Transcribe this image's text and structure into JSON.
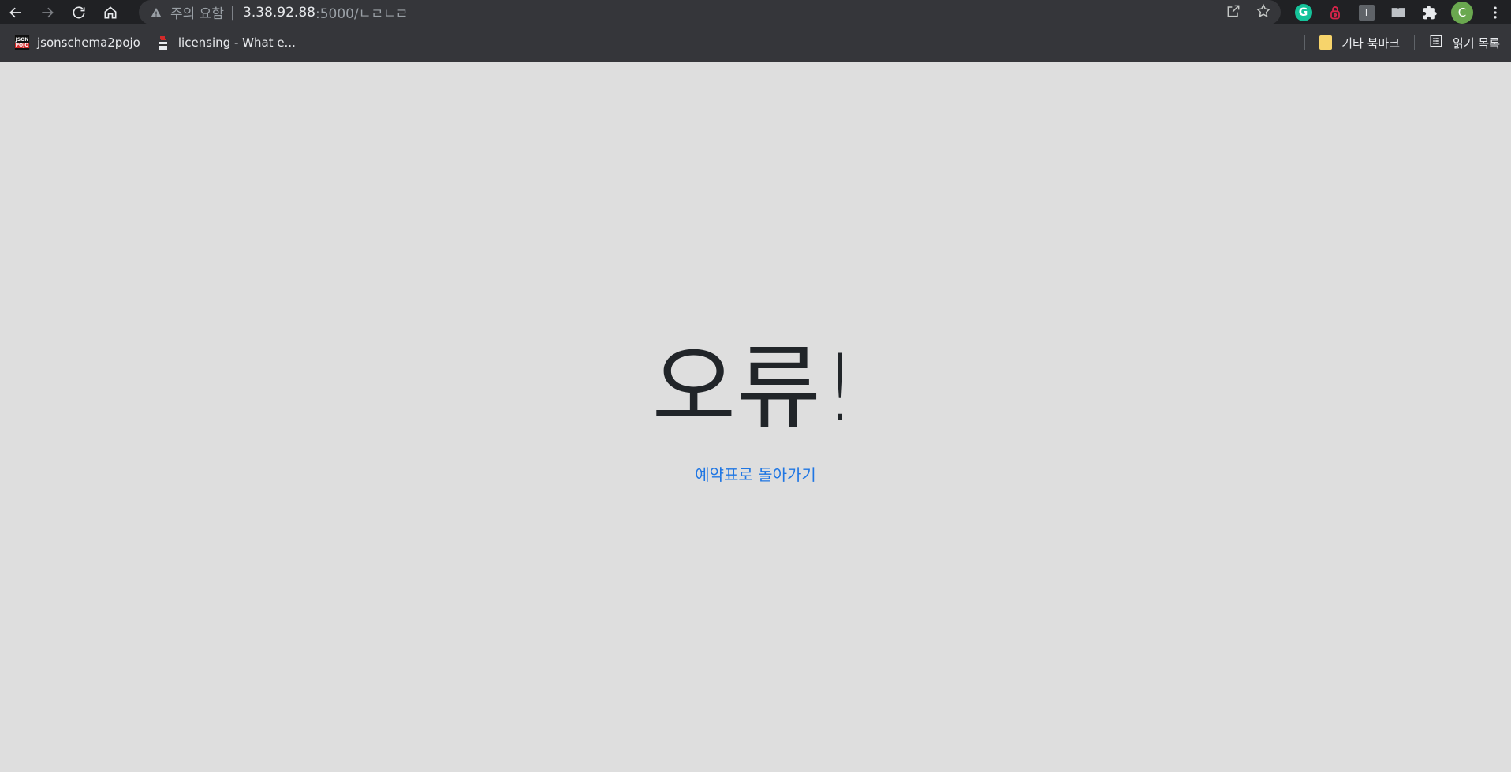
{
  "browser": {
    "address": {
      "security_label": "주의 요함",
      "separator": "|",
      "host": "3.38.92.88",
      "path": ":5000/ㄴㄹㄴㄹ"
    },
    "bookmarks": [
      {
        "label": "jsonschema2pojo"
      },
      {
        "label": "licensing - What e..."
      }
    ],
    "other_bookmarks_label": "기타 북마크",
    "reading_list_label": "읽기 목록",
    "profile_initial": "C",
    "extension_i_label": "I",
    "grammarly_label": "G"
  },
  "page": {
    "title": "오류!",
    "back_link": "예약표로 돌아가기",
    "link_color": "#1f76e3",
    "background": "#dedede"
  }
}
